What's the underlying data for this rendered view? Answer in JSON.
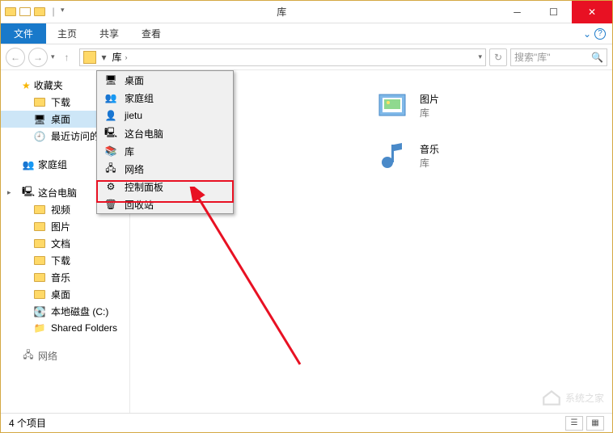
{
  "window": {
    "title": "库"
  },
  "ribbon": {
    "file": "文件",
    "tabs": [
      "主页",
      "共享",
      "查看"
    ]
  },
  "address": {
    "crumb": "库",
    "sep": "›"
  },
  "search": {
    "placeholder": "搜索\"库\""
  },
  "sidebar": {
    "favorites": {
      "label": "收藏夹",
      "items": [
        "下载",
        "桌面",
        "最近访问的"
      ]
    },
    "homegroup": {
      "label": "家庭组"
    },
    "thispc": {
      "label": "这台电脑",
      "items": [
        "视频",
        "图片",
        "文档",
        "下载",
        "音乐",
        "桌面",
        "本地磁盘 (C:)",
        "Shared Folders"
      ]
    },
    "network_cut": "网络"
  },
  "dropdown": {
    "items": [
      {
        "icon": "desktop",
        "label": "桌面"
      },
      {
        "icon": "homegroup",
        "label": "家庭组"
      },
      {
        "icon": "user",
        "label": "jietu"
      },
      {
        "icon": "computer",
        "label": "这台电脑"
      },
      {
        "icon": "library",
        "label": "库"
      },
      {
        "icon": "network",
        "label": "网络"
      },
      {
        "icon": "control",
        "label": "控制面板"
      },
      {
        "icon": "recycle",
        "label": "回收站"
      }
    ]
  },
  "content": {
    "items": [
      {
        "name": "图片",
        "type": "库",
        "icon": "pics"
      },
      {
        "name": "音乐",
        "type": "库",
        "icon": "music"
      }
    ]
  },
  "statusbar": {
    "count": "4 个项目"
  },
  "watermark": "系统之家"
}
